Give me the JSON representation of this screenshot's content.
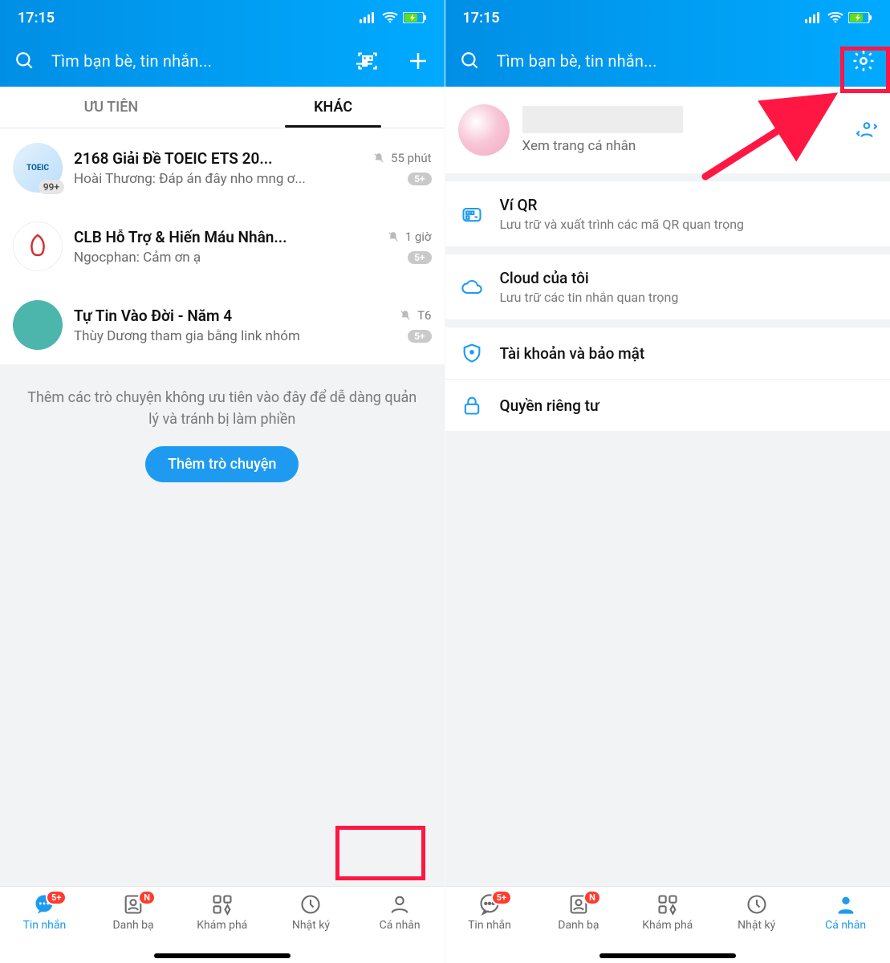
{
  "status": {
    "time": "17:15"
  },
  "search": {
    "placeholder": "Tìm bạn bè, tin nhắn..."
  },
  "tabs": {
    "priority": "ƯU TIÊN",
    "other": "KHÁC"
  },
  "chats": [
    {
      "title": "2168 Giải Đề TOEIC ETS 20...",
      "preview": "Hoài Thương: Đáp án đây nho mng ơ...",
      "time": "55 phút",
      "avatar_badge": "99+",
      "badge": "5+"
    },
    {
      "title": "CLB Hỗ Trợ & Hiến Máu Nhân...",
      "preview": "Ngocphan: Cảm ơn ạ",
      "time": "1 giờ",
      "badge": "5+"
    },
    {
      "title": "Tự Tin Vào Đời - Năm 4",
      "preview": "Thùy Dương tham gia bằng link nhóm",
      "time": "T6",
      "badge": "5+"
    }
  ],
  "hint": "Thêm các trò chuyện không ưu tiên vào đây để dễ dàng quản lý và tránh bị làm phiền",
  "add_button": "Thêm trò chuyện",
  "profile": {
    "subtitle": "Xem trang cá nhân"
  },
  "menu": {
    "qr": {
      "title": "Ví QR",
      "sub": "Lưu trữ và xuất trình các mã QR quan trọng"
    },
    "cloud": {
      "title": "Cloud của tôi",
      "sub": "Lưu trữ các tin nhắn quan trọng"
    },
    "security": {
      "title": "Tài khoản và bảo mật"
    },
    "privacy": {
      "title": "Quyền riêng tư"
    }
  },
  "nav": {
    "messages": {
      "label": "Tin nhắn",
      "badge": "5+"
    },
    "contacts": {
      "label": "Danh bạ",
      "badge": "N"
    },
    "discover": {
      "label": "Khám phá"
    },
    "diary": {
      "label": "Nhật ký"
    },
    "me": {
      "label": "Cá nhân"
    }
  }
}
